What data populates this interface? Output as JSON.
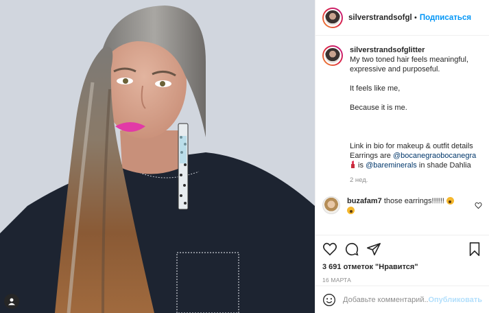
{
  "header": {
    "username": "silverstrandsofglitte",
    "separator": "•",
    "follow_label": "Подписаться"
  },
  "caption": {
    "username": "silverstrandsofglitter",
    "line1": "My two toned hair feels meaningful, expressive and purposeful.",
    "line2": "It feels like me,",
    "line3": "Because it is me.",
    "line4": "Link in bio for makeup & outfit details",
    "earrings_prefix": "Earrings are ",
    "earrings_mention": "@bocanegraobocanegra",
    "is_text": " is ",
    "brand_mention": "@bareminerals",
    "shade_text": " in shade Dahlia",
    "time_ago": "2 нед."
  },
  "comments": [
    {
      "username": "buzafam7",
      "text": "those earrings!!!!!!"
    }
  ],
  "actions": {
    "likes_text": "3 691 отметок \"Нравится\"",
    "date": "16 МАРТА"
  },
  "add_comment": {
    "placeholder": "Добавьте комментарий...",
    "publish_label": "Опубликовать"
  },
  "icons": {
    "like": "heart-icon",
    "comment": "comment-icon",
    "share": "paper-plane-icon",
    "save": "bookmark-icon",
    "emoji": "smiley-icon",
    "user_tag": "user-tag-icon"
  },
  "colors": {
    "follow": "#0095f6",
    "publish_disabled": "#b2dffc",
    "mention": "#00376b"
  }
}
